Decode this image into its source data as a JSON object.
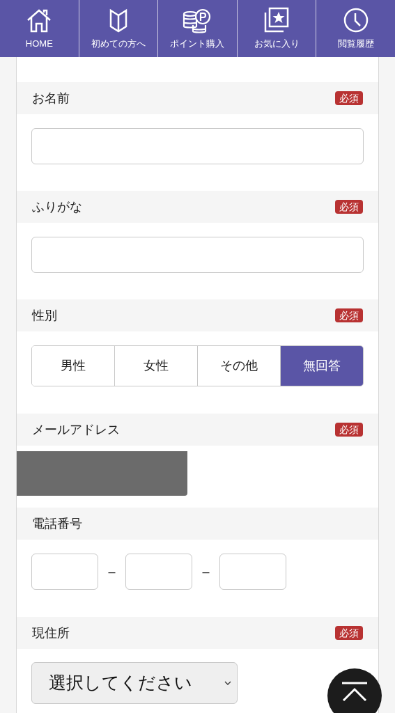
{
  "nav": [
    {
      "label": "HOME",
      "kind": "home"
    },
    {
      "label": "初めての方へ",
      "kind": "beginner"
    },
    {
      "label": "ポイント購入",
      "kind": "points"
    },
    {
      "label": "お気に入り",
      "kind": "favorite"
    },
    {
      "label": "閲覧履歴",
      "kind": "history"
    }
  ],
  "sections": [
    {
      "label": "お名前",
      "required_badge": "必須",
      "kind": "text"
    },
    {
      "label": "ふりがな",
      "required_badge": "必須",
      "kind": "text"
    },
    {
      "label": "性別",
      "required_badge": "必須",
      "kind": "choice",
      "options": [
        {
          "label": "男性",
          "selected": false
        },
        {
          "label": "女性",
          "selected": false
        },
        {
          "label": "その他",
          "selected": false
        },
        {
          "label": "無回答",
          "selected": true
        }
      ]
    },
    {
      "label": "メールアドレス",
      "required_badge": "必須",
      "kind": "redacted"
    },
    {
      "label": "電話番号",
      "kind": "phone",
      "separators": [
        "–",
        "–"
      ]
    },
    {
      "label": "現住所",
      "required_badge": "必須",
      "kind": "select",
      "value": "選択してください"
    }
  ]
}
